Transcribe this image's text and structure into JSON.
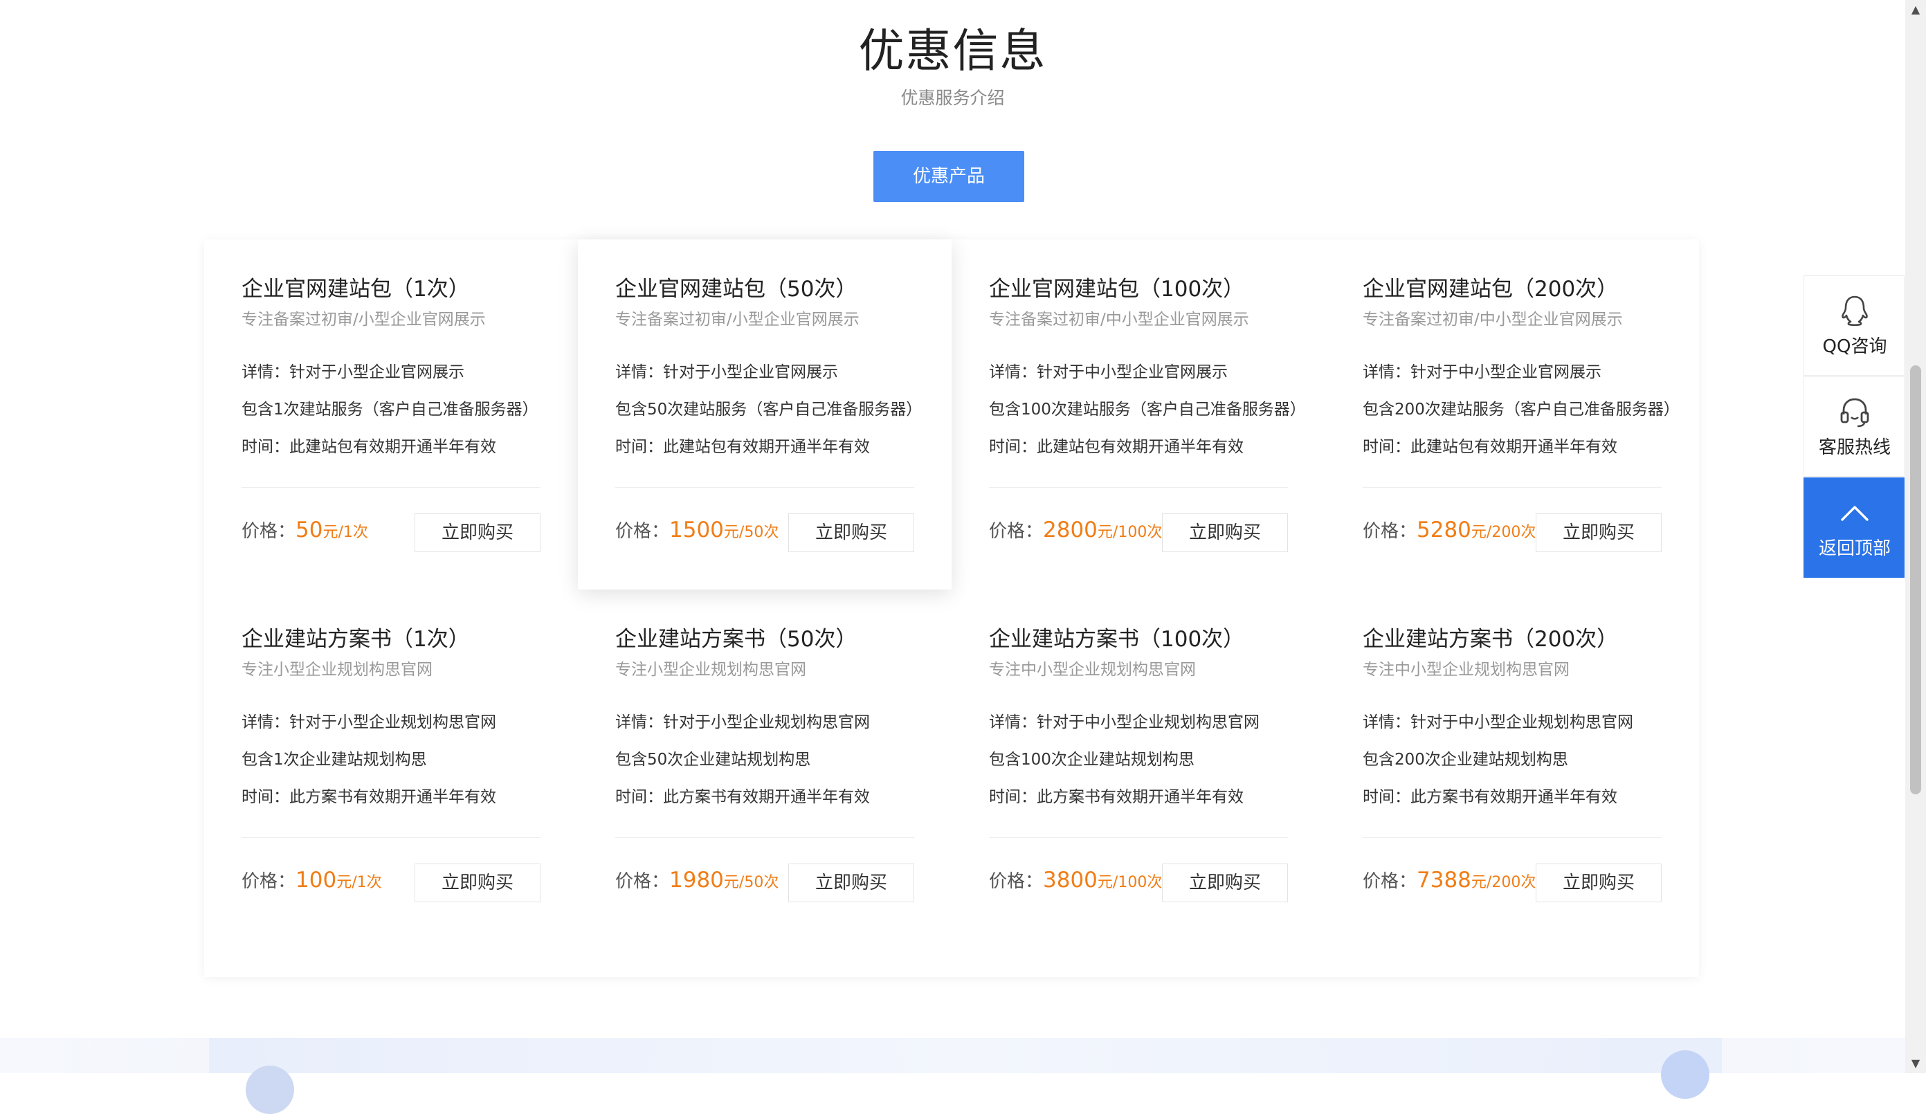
{
  "section": {
    "title": "优惠信息",
    "subtitle": "优惠服务介绍",
    "tab_label": "优惠产品"
  },
  "cards": [
    {
      "title": "企业官网建站包（1次）",
      "tagline": "专注备案过初审/小型企业官网展示",
      "details": [
        "详情：针对于小型企业官网展示",
        "包含1次建站服务（客户自己准备服务器）",
        "时间：此建站包有效期开通半年有效"
      ],
      "price_label": "价格：",
      "price": "50",
      "unit": "元/1次",
      "buy": "立即购买"
    },
    {
      "title": "企业官网建站包（50次）",
      "tagline": "专注备案过初审/小型企业官网展示",
      "details": [
        "详情：针对于小型企业官网展示",
        "包含50次建站服务（客户自己准备服务器）",
        "时间：此建站包有效期开通半年有效"
      ],
      "price_label": "价格：",
      "price": "1500",
      "unit": "元/50次",
      "buy": "立即购买"
    },
    {
      "title": "企业官网建站包（100次）",
      "tagline": "专注备案过初审/中小型企业官网展示",
      "details": [
        "详情：针对于中小型企业官网展示",
        "包含100次建站服务（客户自己准备服务器）",
        "时间：此建站包有效期开通半年有效"
      ],
      "price_label": "价格：",
      "price": "2800",
      "unit": "元/100次",
      "buy": "立即购买"
    },
    {
      "title": "企业官网建站包（200次）",
      "tagline": "专注备案过初审/中小型企业官网展示",
      "details": [
        "详情：针对于中小型企业官网展示",
        "包含200次建站服务（客户自己准备服务器）",
        "时间：此建站包有效期开通半年有效"
      ],
      "price_label": "价格：",
      "price": "5280",
      "unit": "元/200次",
      "buy": "立即购买"
    },
    {
      "title": "企业建站方案书（1次）",
      "tagline": "专注小型企业规划构思官网",
      "details": [
        "详情：针对于小型企业规划构思官网",
        "包含1次企业建站规划构思",
        "时间：此方案书有效期开通半年有效"
      ],
      "price_label": "价格：",
      "price": "100",
      "unit": "元/1次",
      "buy": "立即购买"
    },
    {
      "title": "企业建站方案书（50次）",
      "tagline": "专注小型企业规划构思官网",
      "details": [
        "详情：针对于小型企业规划构思官网",
        "包含50次企业建站规划构思",
        "时间：此方案书有效期开通半年有效"
      ],
      "price_label": "价格：",
      "price": "1980",
      "unit": "元/50次",
      "buy": "立即购买"
    },
    {
      "title": "企业建站方案书（100次）",
      "tagline": "专注中小型企业规划构思官网",
      "details": [
        "详情：针对于中小型企业规划构思官网",
        "包含100次企业建站规划构思",
        "时间：此方案书有效期开通半年有效"
      ],
      "price_label": "价格：",
      "price": "3800",
      "unit": "元/100次",
      "buy": "立即购买"
    },
    {
      "title": "企业建站方案书（200次）",
      "tagline": "专注中小型企业规划构思官网",
      "details": [
        "详情：针对于中小型企业规划构思官网",
        "包含200次企业建站规划构思",
        "时间：此方案书有效期开通半年有效"
      ],
      "price_label": "价格：",
      "price": "7388",
      "unit": "元/200次",
      "buy": "立即购买"
    }
  ],
  "side": {
    "qq_label": "QQ咨询",
    "hotline_label": "客服热线",
    "top_label": "返回顶部"
  },
  "colors": {
    "accent": "#4b8ef6",
    "price": "#f07d16",
    "side_active": "#2a73e8"
  },
  "icons": {
    "qq": "qq-icon",
    "hotline": "headset-icon",
    "top": "chevron-up-icon"
  }
}
